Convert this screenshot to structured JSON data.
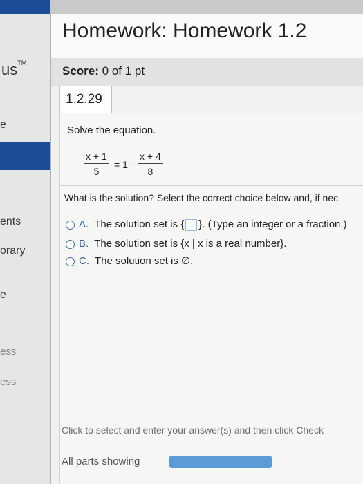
{
  "sidebar": {
    "brand": "us",
    "brand_tm": "TM",
    "items": [
      "ents",
      "orary",
      "e",
      "ess",
      "ess"
    ],
    "partial_glyph": "e"
  },
  "header": {
    "title": "Homework: Homework 1.2"
  },
  "score": {
    "label": "Score:",
    "value": "0 of 1 pt"
  },
  "question": {
    "number": "1.2.29",
    "instruction": "Solve the equation.",
    "equation": {
      "lhs_num": "x + 1",
      "lhs_den": "5",
      "middle": "= 1 −",
      "rhs_num": "x + 4",
      "rhs_den": "8"
    },
    "prompt": "What is the solution? Select the correct choice below and, if nec",
    "choices": [
      {
        "letter": "A.",
        "text_before": "The solution set is {",
        "text_after": "}. (Type an integer or a fraction.)"
      },
      {
        "letter": "B.",
        "text": "The solution set is {x | x is a real number}."
      },
      {
        "letter": "C.",
        "text": "The solution set is ∅."
      }
    ]
  },
  "footer": {
    "instruction": "Click to select and enter your answer(s) and then click Check",
    "parts_label": "All parts showing",
    "progress_fraction": 1.0
  },
  "colors": {
    "brand_blue": "#1b4c95",
    "radio_blue": "#3b6fb5",
    "progress_fill": "#5a9bd8"
  }
}
